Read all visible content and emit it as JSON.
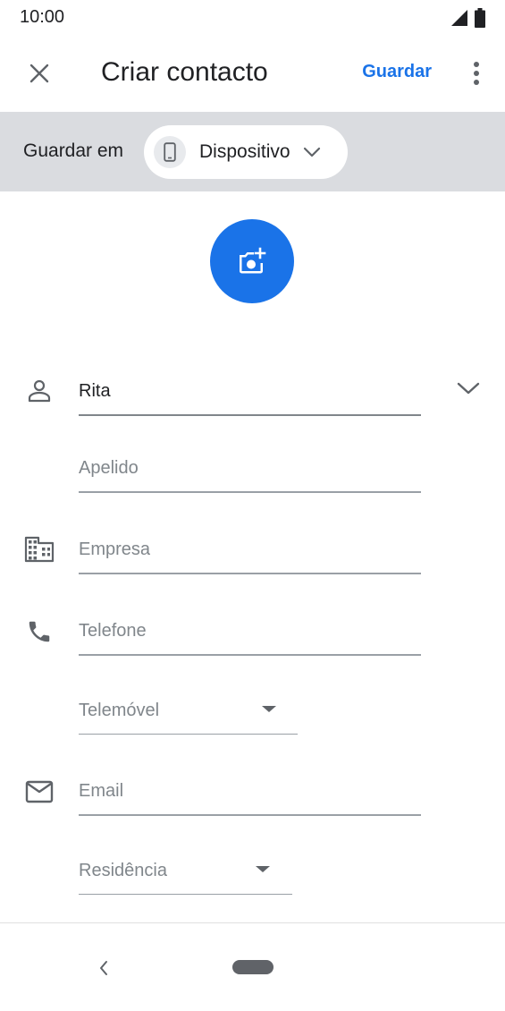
{
  "status_bar": {
    "time": "10:00",
    "icons": [
      "signal-icon",
      "battery-icon"
    ]
  },
  "app_bar": {
    "title": "Criar contacto",
    "save_label": "Guardar",
    "close_icon": "close-icon",
    "overflow_icon": "more-vert-icon"
  },
  "save_in": {
    "label": "Guardar em",
    "account": "Dispositivo",
    "account_icon": "phone-device-icon"
  },
  "photo": {
    "icon": "add-photo-icon",
    "color": "#1a73e8"
  },
  "form": {
    "first_name": {
      "value": "Rita",
      "placeholder": ""
    },
    "surname": {
      "value": "",
      "placeholder": "Apelido"
    },
    "company": {
      "value": "",
      "placeholder": "Empresa"
    },
    "phone": {
      "value": "",
      "placeholder": "Telefone"
    },
    "phone_type": "Telemóvel",
    "email": {
      "value": "",
      "placeholder": "Email"
    },
    "email_type": "Residência"
  },
  "colors": {
    "accent": "#1a73e8",
    "band": "#dadce0"
  }
}
